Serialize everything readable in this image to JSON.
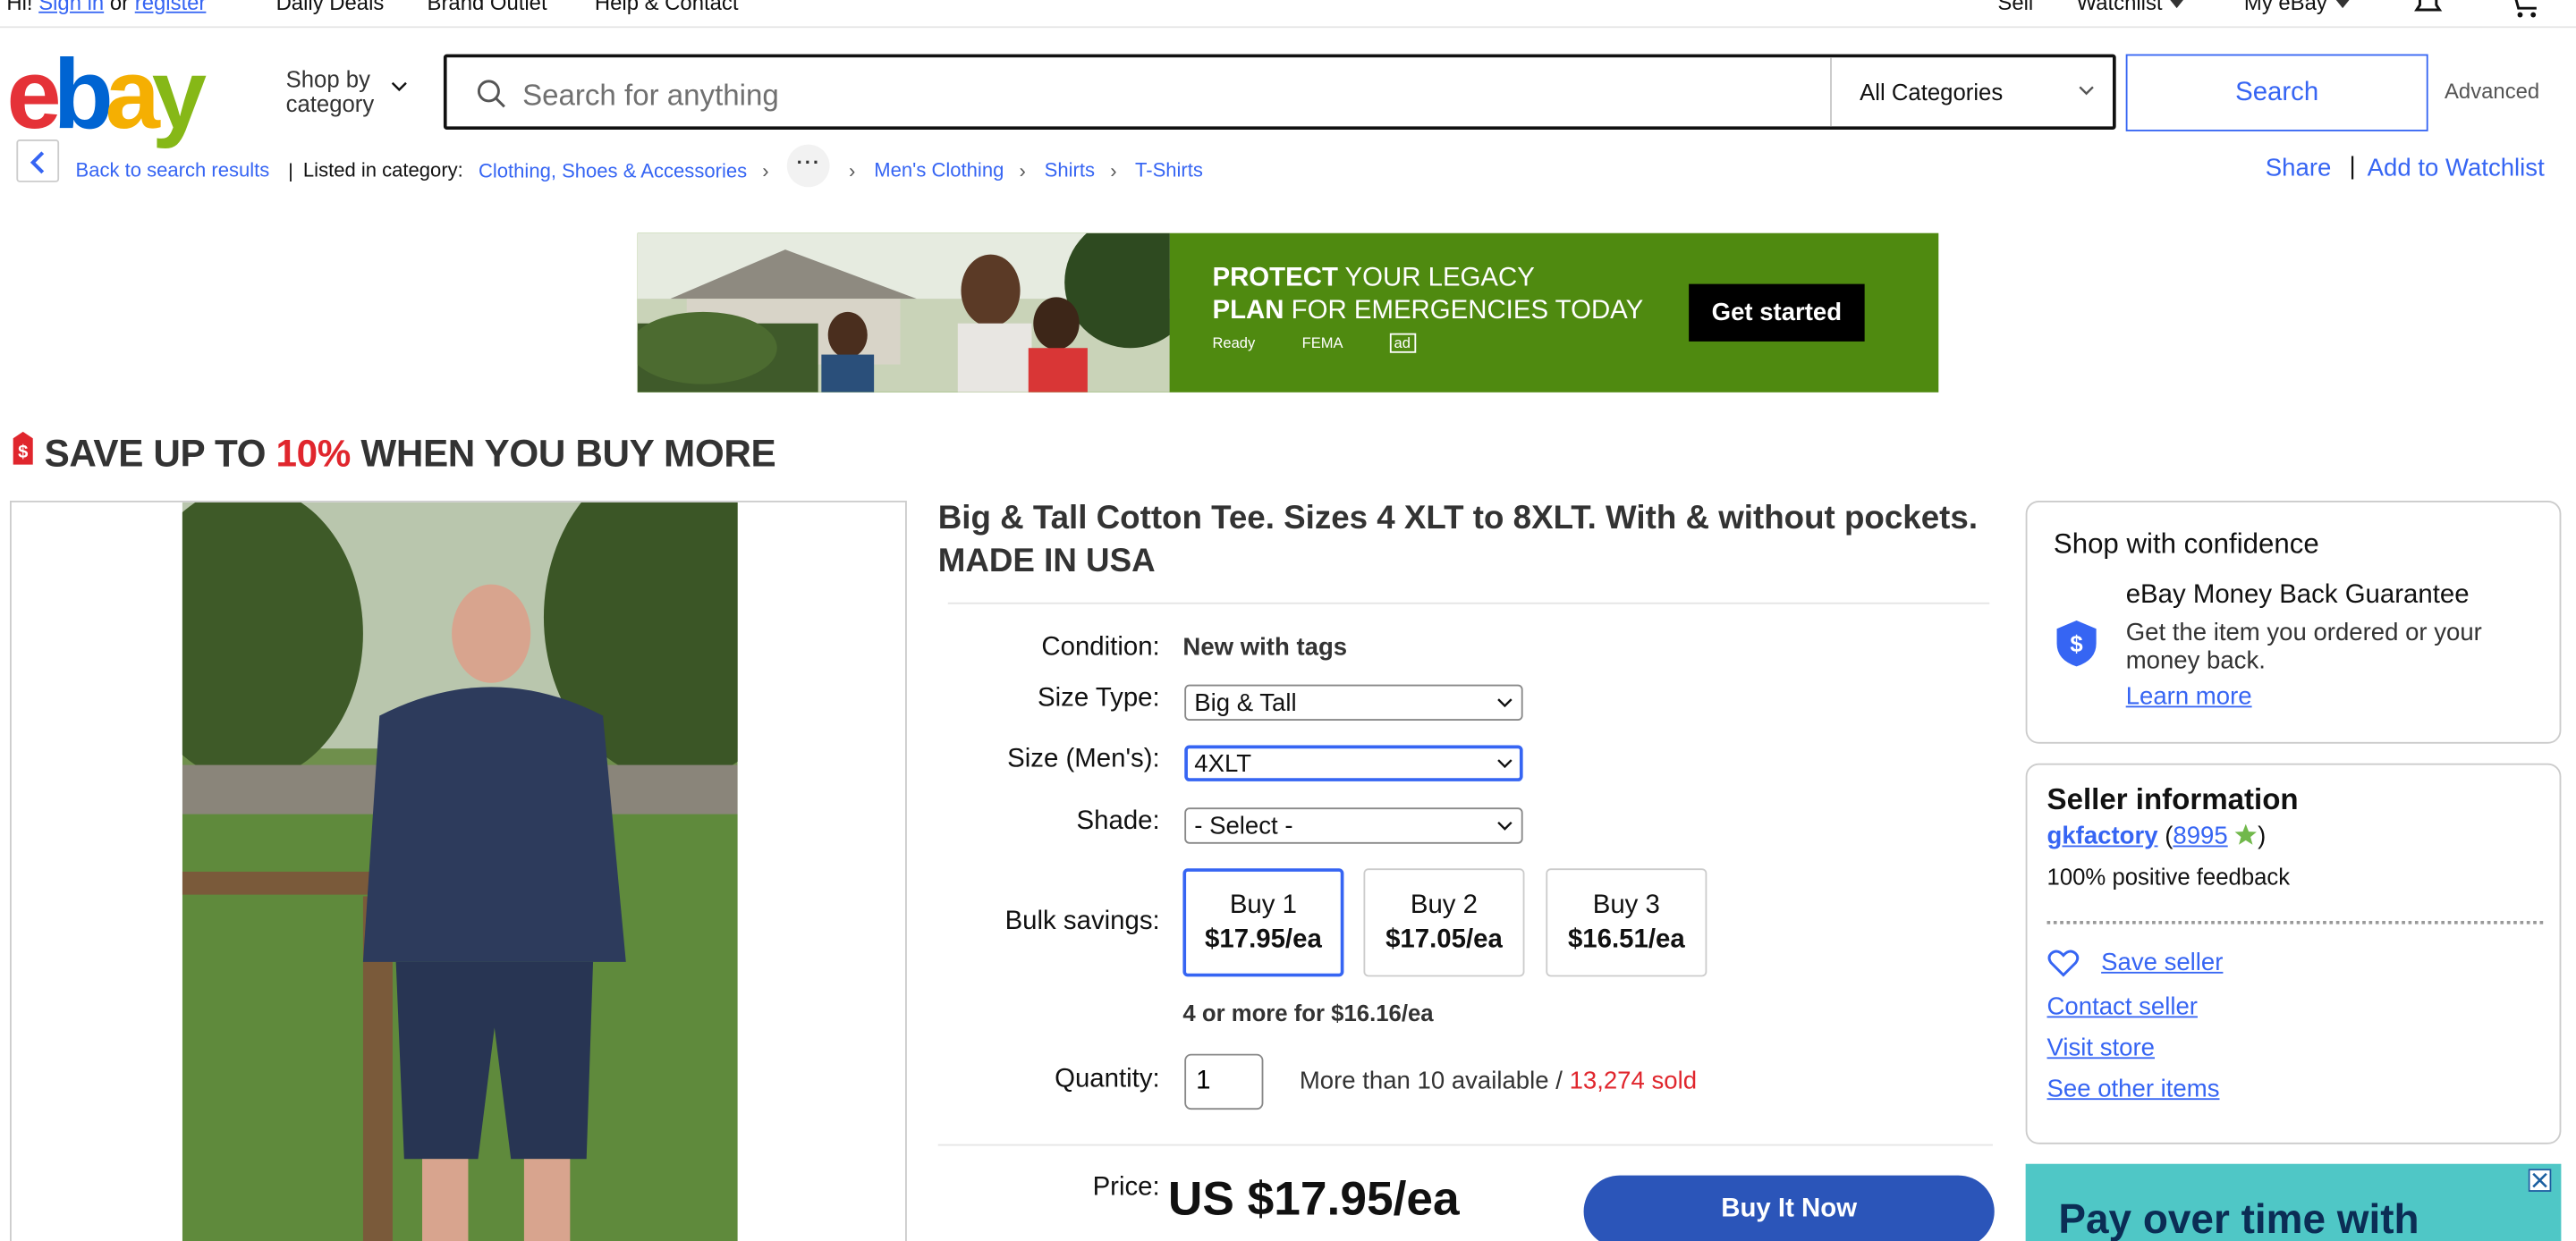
{
  "topbar": {
    "greeting": "Hi!",
    "sign_in": "Sign in",
    "or": "or",
    "register": "register",
    "daily_deals": "Daily Deals",
    "brand_outlet": "Brand Outlet",
    "help": "Help & Contact",
    "sell": "Sell",
    "watchlist": "Watchlist",
    "my_ebay": "My eBay"
  },
  "header": {
    "logo": [
      "e",
      "b",
      "a",
      "y"
    ],
    "shop_by_1": "Shop by",
    "shop_by_2": "category",
    "search_placeholder": "Search for anything",
    "category_select": "All Categories",
    "search_button": "Search",
    "advanced": "Advanced"
  },
  "breadcrumb": {
    "back": "Back to search results",
    "listed": "Listed in category:",
    "items": [
      "Clothing, Shoes & Accessories",
      "Men's Clothing",
      "Shirts",
      "T-Shirts"
    ],
    "share": "Share",
    "separator": "|",
    "add_watchlist": "Add to Watchlist"
  },
  "ad_banner": {
    "line1_bold": "PROTECT",
    "line1_rest": "YOUR LEGACY",
    "line2_bold": "PLAN",
    "line2_rest": "FOR EMERGENCIES TODAY",
    "logo_ready": "Ready",
    "logo_fema": "FEMA",
    "logo_ad": "ad",
    "cta": "Get started"
  },
  "promo": {
    "pre": "SAVE UP TO ",
    "pct": "10%",
    "post": " WHEN YOU BUY MORE"
  },
  "product": {
    "title": "Big & Tall Cotton Tee. Sizes 4 XLT to 8XLT. With & without pockets. MADE IN USA",
    "condition_label": "Condition:",
    "condition_value": "New with tags",
    "size_type_label": "Size Type:",
    "size_type_value": "Big & Tall",
    "size_label": "Size (Men's):",
    "size_value": "4XLT",
    "shade_label": "Shade:",
    "shade_value": "- Select -",
    "bulk_label": "Bulk savings:",
    "bulk": [
      {
        "qty": "Buy 1",
        "price": "$17.95/ea"
      },
      {
        "qty": "Buy 2",
        "price": "$17.05/ea"
      },
      {
        "qty": "Buy 3",
        "price": "$16.51/ea"
      }
    ],
    "more_note": "4 or more for $16.16/ea",
    "quantity_label": "Quantity:",
    "quantity_value": "1",
    "available": "More than 10 available / ",
    "sold": "13,274 sold",
    "price_label": "Price:",
    "price_value": "US $17.95/ea",
    "buy_now": "Buy It Now"
  },
  "confidence": {
    "title": "Shop with confidence",
    "mbg_title": "eBay Money Back Guarantee",
    "mbg_desc": "Get the item you ordered or your money back.",
    "learn_more": "Learn more"
  },
  "seller": {
    "title": "Seller information",
    "name": "gkfactory",
    "score": "8995",
    "feedback": "100% positive feedback",
    "save_seller": "Save seller",
    "contact": "Contact seller",
    "visit_store": "Visit store",
    "see_other": "See other items"
  },
  "side_ad": {
    "text": "Pay over time with"
  },
  "colors": {
    "link": "#3665f3",
    "buy_button": "#2b55b9",
    "sale_red": "#e0262d",
    "ad_green": "#4f8a10"
  }
}
